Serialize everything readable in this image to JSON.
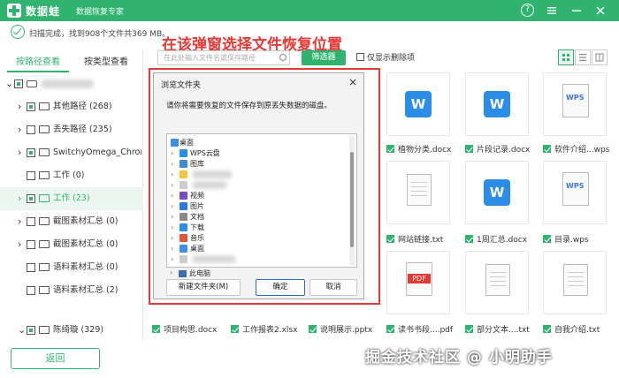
{
  "titlebar": {
    "app_name": "数据蛙",
    "subtitle": "数据恢复专家",
    "help": "?",
    "icons": [
      "logo-icon",
      "help-icon",
      "menu-icon",
      "minimize-icon",
      "close-icon"
    ]
  },
  "scan": {
    "status": "扫描完成，找到908个文件共369 MB。"
  },
  "annotation": "在该弹窗选择文件恢复位置",
  "left": {
    "tab_path": "按路径查看",
    "tab_type": "按类型查看",
    "tree": [
      {
        "label": "其他路径 (268)"
      },
      {
        "label": "丢失路径 (235)"
      },
      {
        "label": "SwitchyOmega_Chromium"
      },
      {
        "label": "工作 (0)"
      },
      {
        "label": "工作 (23)"
      },
      {
        "label": "截图素材汇总 (0)"
      },
      {
        "label": "截图素材汇总 (0)"
      },
      {
        "label": "语料素材汇总 (0)"
      },
      {
        "label": "语料素材汇总 (2)"
      },
      {
        "label": "陈绮璇 (329)"
      }
    ],
    "back_button": "返回"
  },
  "toolbar": {
    "search_placeholder": "在此处输入文件名或保存路径",
    "filter_button": "筛选器",
    "only_deleted": "仅显示删除项"
  },
  "files": {
    "row1": [
      "植物分类.docx",
      "片段记录.docx",
      "软件介绍...wps"
    ],
    "row2": [
      "网站链接.txt",
      "1周汇总.docx",
      "目录.wps"
    ],
    "row3": [
      "读书书段....pdf",
      "部分文本....txt",
      "自我介绍.txt"
    ],
    "bottom_row": [
      "项目构思.docx",
      "工作报表2.xlsx",
      "说明展示.pptx"
    ],
    "wps_label": "WPS",
    "pdf_label": "PDF",
    "word_letter": "W"
  },
  "dialog": {
    "title": "浏览文件夹",
    "close": "×",
    "message": "请你将需要恢复的文件保存到原丢失数据的磁盘。",
    "tree": [
      {
        "label": "桌面",
        "chev": "",
        "color": "#3c8ee6"
      },
      {
        "label": "WPS云盘",
        "chev": "›",
        "color": "#2b8de8"
      },
      {
        "label": "图库",
        "chev": "›",
        "color": "#3a8cd6"
      },
      {
        "label": "",
        "chev": "›",
        "color": "#f4c542"
      },
      {
        "label": "",
        "chev": "›",
        "color": "#cccccc"
      },
      {
        "label": "视频",
        "chev": "›",
        "color": "#7a4bc7"
      },
      {
        "label": "图片",
        "chev": "›",
        "color": "#2e7ad9"
      },
      {
        "label": "文档",
        "chev": "›",
        "color": "#8a8a8a"
      },
      {
        "label": "下载",
        "chev": "›",
        "color": "#2b8de8"
      },
      {
        "label": "音乐",
        "chev": "›",
        "color": "#e5533b"
      },
      {
        "label": "桌面",
        "chev": "›",
        "color": "#3c8ee6"
      },
      {
        "label": "",
        "chev": "›",
        "color": "#cccccc"
      },
      {
        "label": "此电脑",
        "chev": "›",
        "color": "#3a6fb0"
      }
    ],
    "new_folder": "新建文件夹(M)",
    "ok": "确定",
    "cancel": "取消"
  },
  "watermark": "掘金技术社区 @ 小明助手",
  "colors": {
    "brand_green": "#2fb36f",
    "annotation_red": "#e53935",
    "word_blue": "#2b8de8"
  }
}
